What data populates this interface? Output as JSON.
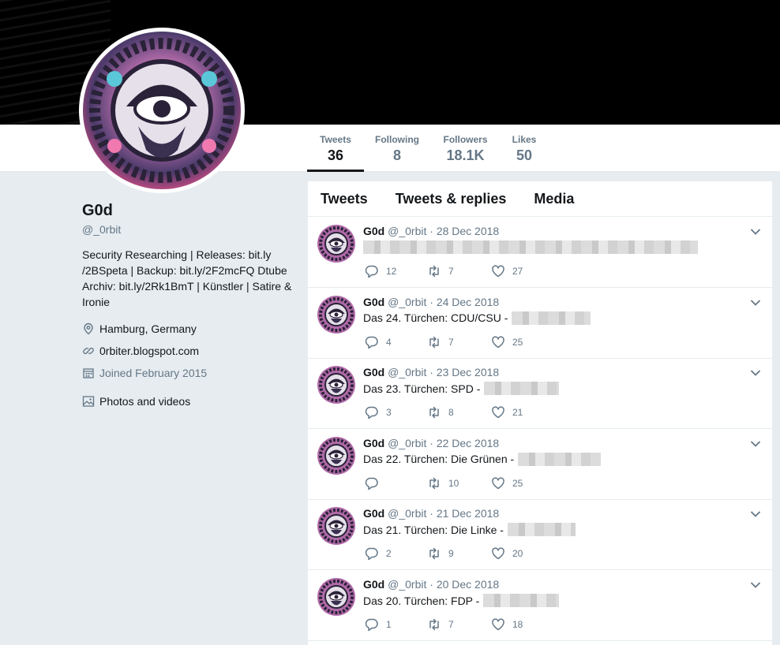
{
  "profile": {
    "name": "G0d",
    "handle": "@_0rbit",
    "bio": "Security Researching | Releases: bit.ly /2BSpeta | Backup: bit.ly/2F2mcFQ Dtube Archiv: bit.ly/2Rk1BmT | Künstler | Satire & Ironie",
    "location": "Hamburg, Germany",
    "website": "0rbiter.blogspot.com",
    "joined": "Joined February 2015",
    "photos_label": "Photos and videos"
  },
  "nav": [
    {
      "label": "Tweets",
      "value": "36"
    },
    {
      "label": "Following",
      "value": "8"
    },
    {
      "label": "Followers",
      "value": "18.1K"
    },
    {
      "label": "Likes",
      "value": "50"
    }
  ],
  "tabs": [
    "Tweets",
    "Tweets & replies",
    "Media"
  ],
  "tweets": [
    {
      "name": "G0d",
      "handle": "@_0rbit",
      "date": "28 Dec 2018",
      "text": "",
      "replies": "12",
      "retweets": "7",
      "likes": "27"
    },
    {
      "name": "G0d",
      "handle": "@_0rbit",
      "date": "24 Dec 2018",
      "text": "Das 24. Türchen: CDU/CSU -",
      "replies": "4",
      "retweets": "7",
      "likes": "25"
    },
    {
      "name": "G0d",
      "handle": "@_0rbit",
      "date": "23 Dec 2018",
      "text": "Das 23. Türchen: SPD -",
      "replies": "3",
      "retweets": "8",
      "likes": "21"
    },
    {
      "name": "G0d",
      "handle": "@_0rbit",
      "date": "22 Dec 2018",
      "text": "Das 22. Türchen: Die Grünen -",
      "replies": "",
      "retweets": "10",
      "likes": "25"
    },
    {
      "name": "G0d",
      "handle": "@_0rbit",
      "date": "21 Dec 2018",
      "text": "Das 21. Türchen: Die Linke -",
      "replies": "2",
      "retweets": "9",
      "likes": "20"
    },
    {
      "name": "G0d",
      "handle": "@_0rbit",
      "date": "20 Dec 2018",
      "text": "Das 20. Türchen: FDP -",
      "replies": "1",
      "retweets": "7",
      "likes": "18"
    }
  ],
  "icons": {
    "location": "location-pin-icon",
    "website": "link-icon",
    "joined": "calendar-icon",
    "photos": "image-icon",
    "reply": "reply-icon",
    "retweet": "retweet-icon",
    "like": "heart-icon",
    "caret": "chevron-down-icon"
  },
  "colors": {
    "accent": "#1da1f2",
    "text": "#14171a",
    "muted": "#657786",
    "background": "#e6ecf0"
  }
}
